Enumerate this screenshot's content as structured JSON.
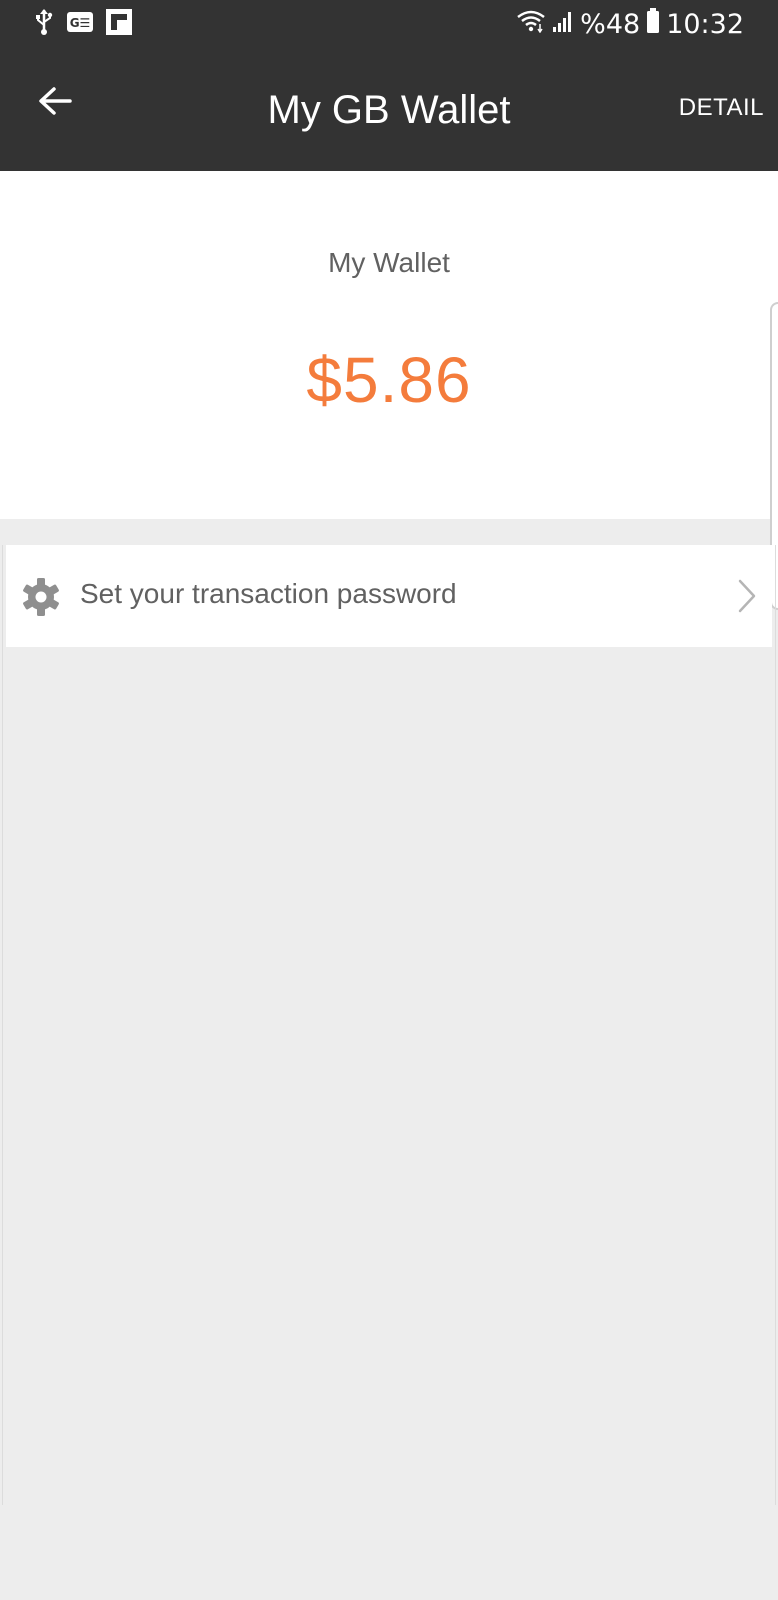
{
  "status_bar": {
    "battery_percent": "%48",
    "time": "10:32",
    "left_icons": [
      "usb-icon",
      "gallery-icon",
      "flipboard-icon"
    ],
    "right_icons": [
      "wifi-icon",
      "signal-icon",
      "battery-icon"
    ]
  },
  "app_bar": {
    "title": "My GB Wallet",
    "detail_label": "DETAIL",
    "back_icon": "arrow-left-icon"
  },
  "wallet": {
    "label": "My Wallet",
    "amount": "$5.86"
  },
  "settings": {
    "transaction_password_label": "Set your transaction password",
    "icon": "gear-icon",
    "chevron_icon": "chevron-right-icon"
  },
  "colors": {
    "bar_background": "#333333",
    "accent": "#f47c3c",
    "page_background": "#ededed",
    "text_secondary": "#616161"
  }
}
